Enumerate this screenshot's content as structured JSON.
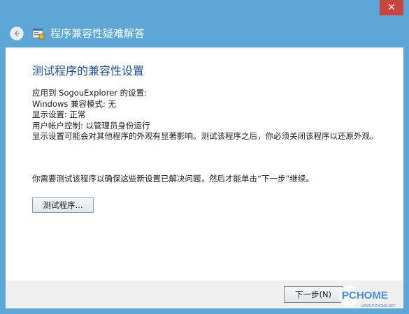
{
  "window": {
    "close_glyph": "✕",
    "header_title": "程序兼容性疑难解答"
  },
  "content": {
    "page_title": "测试程序的兼容性设置",
    "applied_to": "应用到 SogouExplorer 的设置:",
    "compat_mode": "Windows 兼容模式: 无",
    "display_settings": "显示设置: 正常",
    "uac": "用户帐户控制: 以管理员身份运行",
    "display_warning": "显示设置可能会对其他程序的外观有显著影响。测试该程序之后，你必须关闭该程序以还原外观。",
    "notice": "你需要测试该程序以确保这些新设置已解决问题，然后才能单击“下一步”继续。",
    "test_button": "测试程序..."
  },
  "footer": {
    "next_button": "下一步(N)"
  },
  "watermark": {
    "text": "PCHOME",
    "subtext": "WWW.PCHOME.NET"
  },
  "colors": {
    "frame": "#5da7d6",
    "title_blue": "#1e4e8c",
    "close_red": "#c7463f"
  }
}
